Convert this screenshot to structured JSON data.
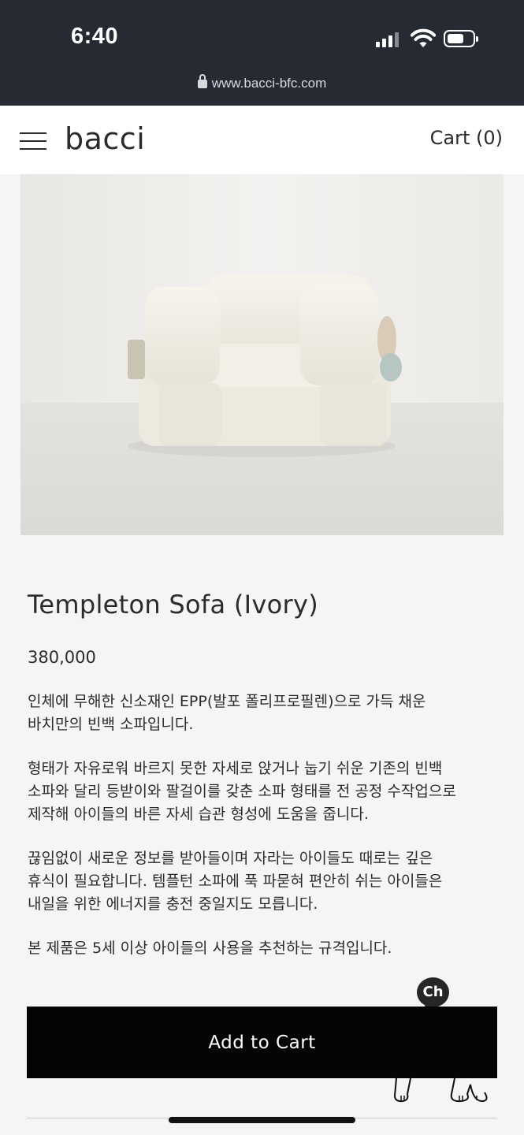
{
  "status_bar": {
    "time": "6:40",
    "url": "www.bacci-bfc.com",
    "icons": [
      "signal-icon",
      "wifi-icon",
      "battery-icon",
      "lock-icon"
    ]
  },
  "header": {
    "logo": "bacci",
    "cart_label": "Cart (0)",
    "menu_icon": "hamburger-menu-icon"
  },
  "product": {
    "image": "ivory-sofa-photo",
    "title": "Templeton Sofa (Ivory)",
    "price": "380,000",
    "description": [
      "인체에 무해한 신소재인 EPP(발포 폴리프로필렌)으로 가득 채운\n바치만의 빈백 소파입니다.",
      "형태가 자유로워 바르지 못한 자세로 앉거나 눕기 쉬운 기존의 빈백\n소파와 달리 등받이와 팔걸이를 갖춘 소파 형태를 전 공정 수작업으로\n제작해 아이들의 바른 자세 습관 형성에 도움을 줍니다.",
      "끊임없이 새로운 정보를 받아들이며 자라는 아이들도 때로는 깊은\n휴식이 필요합니다. 템플턴 소파에 푹 파묻혀 편안히 쉬는 아이들은\n내일을 위한 에너지를 충전 중일지도 모릅니다.",
      "본 제품은 5세 이상 아이들의 사용을 추천하는 규격입니다."
    ],
    "add_to_cart_label": "Add to Cart"
  },
  "chat": {
    "label": "Ch"
  },
  "colors": {
    "status_bg": "#262a33",
    "button_bg": "#050505",
    "page_bg": "#f5f5f5",
    "text": "#2b2b2b"
  }
}
